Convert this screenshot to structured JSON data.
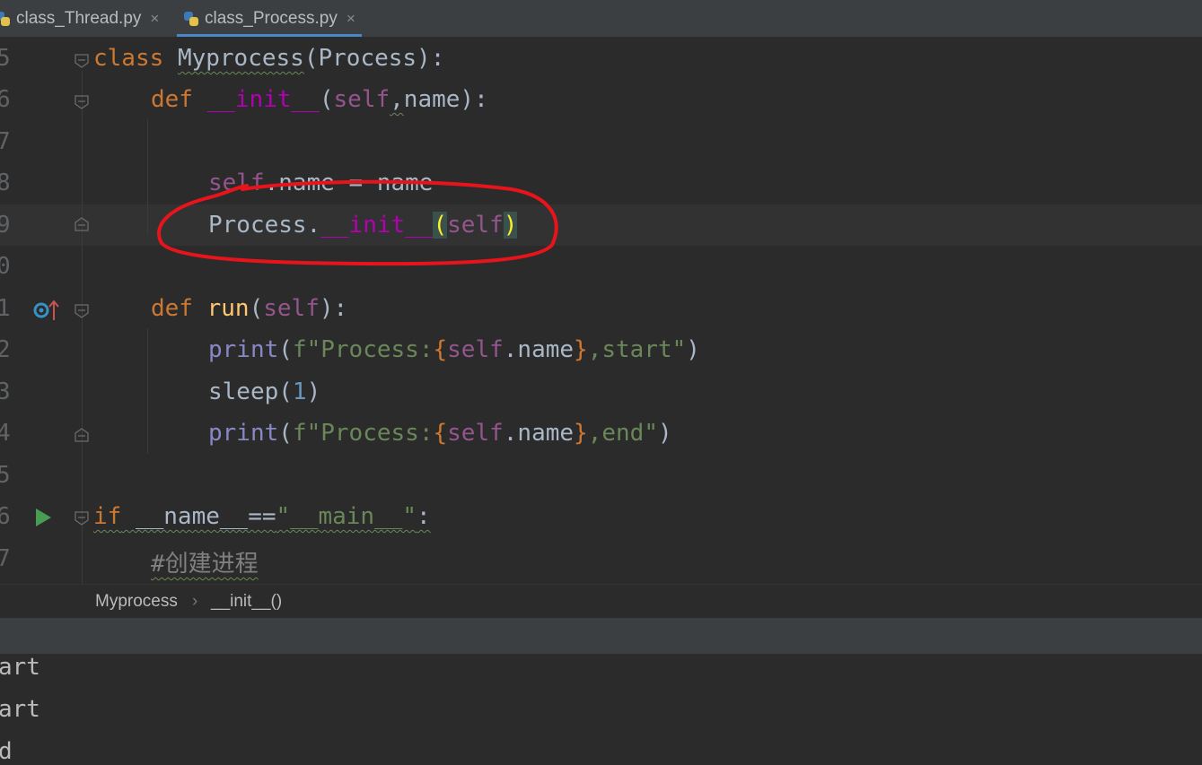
{
  "tabs": [
    {
      "label": "class_Thread.py",
      "close": "×",
      "active": false
    },
    {
      "label": "class_Process.py",
      "close": "×",
      "active": true
    }
  ],
  "gutter": {
    "line_numbers": [
      "5",
      "6",
      "7",
      "8",
      "9",
      "0",
      "1",
      "2",
      "3",
      "4",
      "5",
      "6",
      "7"
    ],
    "override_icon": "override-method-icon",
    "run_icon": "run-triangle-icon"
  },
  "code": {
    "l1": {
      "kw": "class",
      "cls": "Myprocess",
      "base_open": "(Process):"
    },
    "l2": {
      "kw": "def",
      "name": "__init__",
      "p1": "(",
      "self": "self",
      "comma": ",",
      "rest": "name):"
    },
    "l4": {
      "self": "self",
      "rest": ".name = name"
    },
    "l5": {
      "obj": "Process.",
      "magic": "__init__",
      "open": "(",
      "self": "self",
      "close": ")"
    },
    "l7": {
      "kw": "def",
      "fn": "run",
      "open": "(",
      "self": "self",
      "close": "):"
    },
    "l8": {
      "fn": "print",
      "open": "(",
      "prefix": "f\"Process:",
      "lb": "{",
      "self": "self",
      "attr": ".name",
      "rb": "}",
      "tail": ",start\"",
      "close": ")"
    },
    "l9": {
      "fn": "sleep(",
      "num": "1",
      "close": ")"
    },
    "l10": {
      "fn": "print",
      "open": "(",
      "prefix": "f\"Process:",
      "lb": "{",
      "self": "self",
      "attr": ".name",
      "rb": "}",
      "tail": ",end\"",
      "close": ")"
    },
    "l12": {
      "kw": "if",
      "rest": " __name__==",
      "str": "\"__main__\"",
      "colon": ":"
    },
    "l13": {
      "comment": "#创建进程"
    }
  },
  "breadcrumb": {
    "class": "Myprocess",
    "sep": "›",
    "method": "__init__()"
  },
  "console": {
    "lines": [
      "art",
      "art",
      "d"
    ]
  },
  "colors": {
    "keyword": "#cc7832",
    "self": "#94558d",
    "magic": "#b200b2",
    "string": "#6a8759",
    "annotation": "#e8141b"
  }
}
